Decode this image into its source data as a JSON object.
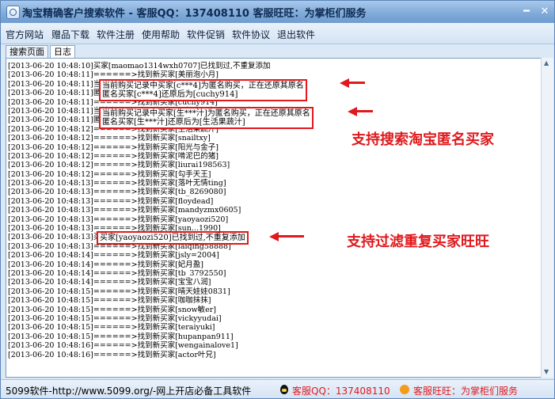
{
  "window": {
    "title": "淘宝精确客户搜索软件 - 客服QQ：137408110 客服旺旺：为掌柜们服务",
    "minimize_glyph": "━",
    "close_glyph": "✕"
  },
  "menu": [
    "官方网站",
    "赠品下载",
    "软件注册",
    "使用帮助",
    "软件促销",
    "软件协议",
    "退出软件"
  ],
  "tabs": {
    "search": "搜索页面",
    "log": "日志"
  },
  "log": [
    "[2013-06-20 10:48:10]买家[maomao1314wxh0707]已找到过,不重复添加",
    "[2013-06-20 10:48:11]======>找到新买家[美丽泡小月]",
    "[2013-06-20 10:48:11]当前购买记录中买家[c***4]为匿名购买，正在还原其原名",
    "[2013-06-20 10:48:11]匿名买家[c***4]还原后为[cuchy914]",
    "[2013-06-20 10:48:11]======>找到新买家[cuchy914]",
    "[2013-06-20 10:48:11]当前购买记录中买家[生***汁]为匿名购买，正在还原其原名",
    "[2013-06-20 10:48:11]匿名买家[生***汁]还原后为[生活果蔬汁]",
    "[2013-06-20 10:48:12]======>找到新买家[生活果蔬汁]",
    "[2013-06-20 10:48:12]======>找到新买家[snailtxy]",
    "[2013-06-20 10:48:12]======>找到新买家[阳光与金子]",
    "[2013-06-20 10:48:12]======>找到新买家[啃泥巴的猪]",
    "[2013-06-20 10:48:12]======>找到新买家[liurai198563]",
    "[2013-06-20 10:48:12]======>找到新买家[勾手天王]",
    "[2013-06-20 10:48:13]======>找到新买家[落叶无情ting]",
    "[2013-06-20 10:48:13]======>找到新买家[tb_8269080]",
    "[2013-06-20 10:48:13]======>找到新买家[floydead]",
    "[2013-06-20 10:48:13]======>找到新买家[mandyzmx0605]",
    "[2013-06-20 10:48:13]======>找到新买家[yaoyaozi520]",
    "[2013-06-20 10:48:13]======>找到新买家[sun...1990]",
    "[2013-06-20 10:48:13]买家[yaoyaozi520]已找到过,不重复添加",
    "[2013-06-20 10:48:13]======>找到新买家[laiqing58888]",
    "[2013-06-20 10:48:14]======>找到新买家[jsly=2004]",
    "[2013-06-20 10:48:14]======>找到新买家[妃月盈]",
    "[2013-06-20 10:48:14]======>找到新买家[tb_3792550]",
    "[2013-06-20 10:48:14]======>找到新买家[宝宝八润]",
    "[2013-06-20 10:48:15]======>找到新买家[晴天娃娃0831]",
    "[2013-06-20 10:48:15]======>找到新买家[咖咖抹抹]",
    "[2013-06-20 10:48:15]======>找到新买家[snow敏er]",
    "[2013-06-20 10:48:15]======>找到新买家[vickyyudai]",
    "[2013-06-20 10:48:15]======>找到新买家[teraiyuki]",
    "[2013-06-20 10:48:15]======>找到新买家[hupanpan911]",
    "[2013-06-20 10:48:16]======>找到新买家[wengainalove1]",
    "[2013-06-20 10:48:16]======>找到新买家[actor叶兄]"
  ],
  "annotations": {
    "box1_line1": "当前购买记录中买家[c***4]为匿名购买，正在还原其原名",
    "box1_line2": "匿名买家[c***4]还原后为[cuchy914]",
    "box2_line1": "当前购买记录中买家[生***汁]为匿名购买，正在还原其原名",
    "box2_line2": "匿名买家[生***汁]还原后为[生活果蔬汁]",
    "box3": "买家[yaoyaozi520]已找到过,不重复添加",
    "callout1": "支持搜索淘宝匿名买家",
    "callout2": "支持过滤重复买家旺旺"
  },
  "statusbar": {
    "left": "5099软件-http://www.5099.org/-网上开店必备工具软件",
    "qq": "客服QQ：137408110",
    "wangwang": "客服旺旺：为掌柜们服务"
  },
  "colors": {
    "accent_red": "#e0191d",
    "title_blue": "#7ea9d8"
  }
}
